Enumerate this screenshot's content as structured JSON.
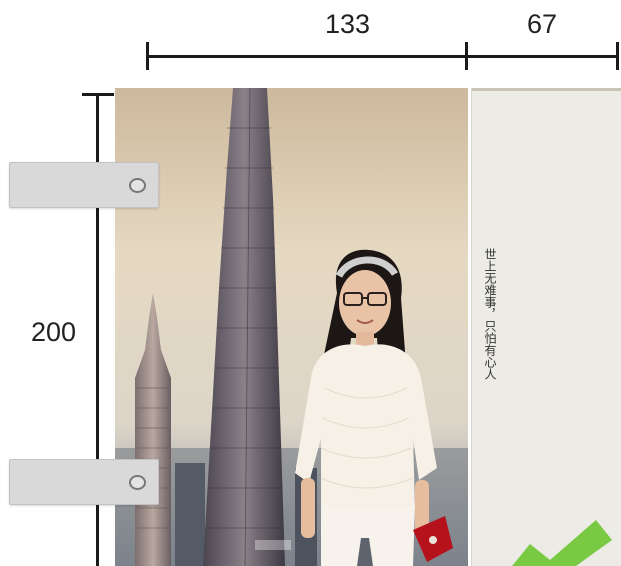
{
  "dimensions": {
    "width_left": "133",
    "width_right": "67",
    "height": "200"
  },
  "quote": {
    "text": "世上无难事，只怕有心人"
  },
  "colors": {
    "panel_background": "#ecebe5",
    "handle_background": "#d9d9d9",
    "check_green": "#7ac943"
  },
  "icons": {
    "handle_knob": "circle-knob-icon",
    "check": "check-mark-icon"
  }
}
